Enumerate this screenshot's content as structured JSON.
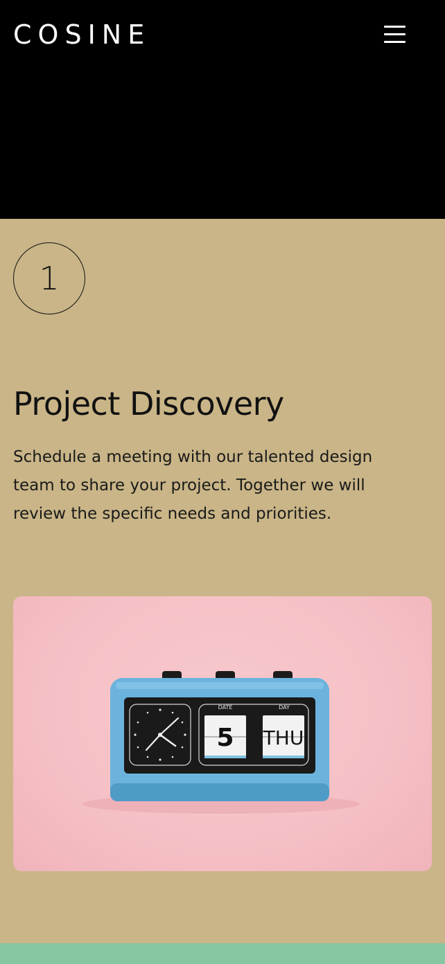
{
  "brand": {
    "logo": "COSINE"
  },
  "header": {
    "menu_icon": "hamburger-menu-icon"
  },
  "step": {
    "number": "1",
    "title": "Project Discovery",
    "description": "Schedule a meeting with our talented design team to share your project. Together we will review the specific needs and priorities."
  },
  "photo": {
    "subject": "blue flip calendar clock on pink background",
    "date_label": "DATE",
    "day_label": "DAY",
    "date_value": "5",
    "day_value": "THU"
  },
  "colors": {
    "header_bg": "#000000",
    "section_bg": "#c9b587",
    "photo_bg": "#f5c0c5",
    "clock_body": "#6bb3dd",
    "next_section_bg": "#86c6a0"
  }
}
